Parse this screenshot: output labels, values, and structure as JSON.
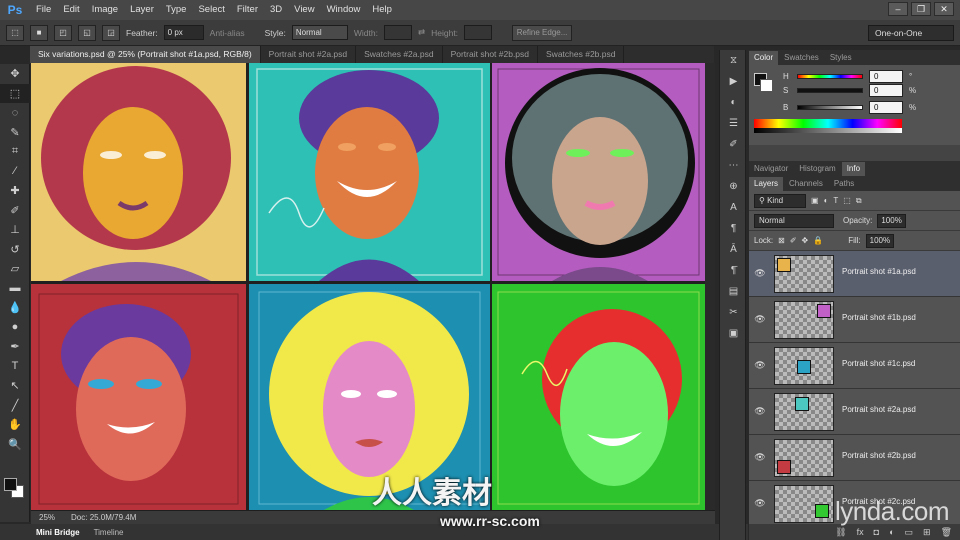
{
  "app": {
    "name": "Ps"
  },
  "menubar": {
    "items": [
      "File",
      "Edit",
      "Image",
      "Layer",
      "Type",
      "Select",
      "Filter",
      "3D",
      "View",
      "Window",
      "Help"
    ],
    "window_buttons": [
      "–",
      "❐",
      "✕"
    ]
  },
  "options": {
    "feather_label": "Feather:",
    "feather_value": "0 px",
    "antialias_label": "Anti-alias",
    "style_label": "Style:",
    "style_value": "Normal",
    "width_label": "Width:",
    "height_label": "Height:",
    "refine_edge": "Refine Edge...",
    "workspace": "One-on-One"
  },
  "doc_tabs": [
    {
      "label": "Six variations.psd @ 25% (Portrait shot #1a.psd, RGB/8)",
      "active": true
    },
    {
      "label": "Portrait shot #2a.psd",
      "active": false
    },
    {
      "label": "Swatches #2a.psd",
      "active": false
    },
    {
      "label": "Portrait shot #2b.psd",
      "active": false
    },
    {
      "label": "Swatches #2b.psd",
      "active": false
    }
  ],
  "status": {
    "zoom": "25%",
    "doc": "Doc: 25.0M/79.4M"
  },
  "bottom_tabs": [
    "Mini Bridge",
    "Timeline"
  ],
  "color_panel": {
    "tabs": [
      "Color",
      "Swatches",
      "Styles"
    ],
    "rows": [
      {
        "label": "H",
        "value": "0",
        "unit": "°"
      },
      {
        "label": "S",
        "value": "0",
        "unit": "%"
      },
      {
        "label": "B",
        "value": "0",
        "unit": "%"
      }
    ]
  },
  "nav_panel": {
    "tabs": [
      "Navigator",
      "Histogram",
      "Info"
    ]
  },
  "layers_panel": {
    "tabs": [
      "Layers",
      "Channels",
      "Paths"
    ],
    "kind_label": "Kind",
    "blend_mode": "Normal",
    "opacity_label": "Opacity:",
    "opacity_value": "100%",
    "lock_label": "Lock:",
    "fill_label": "Fill:",
    "fill_value": "100%",
    "layers": [
      {
        "name": "Portrait shot #1a.psd",
        "selected": true,
        "color": "#e7b34a"
      },
      {
        "name": "Portrait shot #1b.psd",
        "selected": false,
        "color": "#c160c6"
      },
      {
        "name": "Portrait shot #1c.psd",
        "selected": false,
        "color": "#2aa3c5"
      },
      {
        "name": "Portrait shot #2a.psd",
        "selected": false,
        "color": "#4cc8c0"
      },
      {
        "name": "Portrait shot #2b.psd",
        "selected": false,
        "color": "#c43b42"
      },
      {
        "name": "Portrait shot #2c.psd",
        "selected": false,
        "color": "#32c832"
      }
    ]
  },
  "watermarks": {
    "lynda": "lynda.com",
    "cn": "人人素材",
    "url": "www.rr-sc.com"
  },
  "canvas": {
    "panels": [
      {
        "bg": "#ebc96e",
        "hair": "#b4384c",
        "face": "#e9a832",
        "accent": "#7b4fa6"
      },
      {
        "bg": "#2fc0b5",
        "hair": "#5a3a9a",
        "face": "#e07c42",
        "accent": "#d6f0ee"
      },
      {
        "bg": "#b45cbf",
        "hair": "#bfe8ec",
        "face": "#c9a58e",
        "accent": "#111111"
      },
      {
        "bg": "#b8323c",
        "hair": "#6a3a9e",
        "face": "#e06a5a",
        "accent": "#35a9d6"
      },
      {
        "bg": "#1d8fb0",
        "hair": "#f1e94a",
        "face": "#e48ac6",
        "accent": "#3d2f1a"
      },
      {
        "bg": "#2ec42e",
        "hair": "#e62e2e",
        "face": "#6cf06c",
        "accent": "#f3d64a"
      }
    ]
  }
}
